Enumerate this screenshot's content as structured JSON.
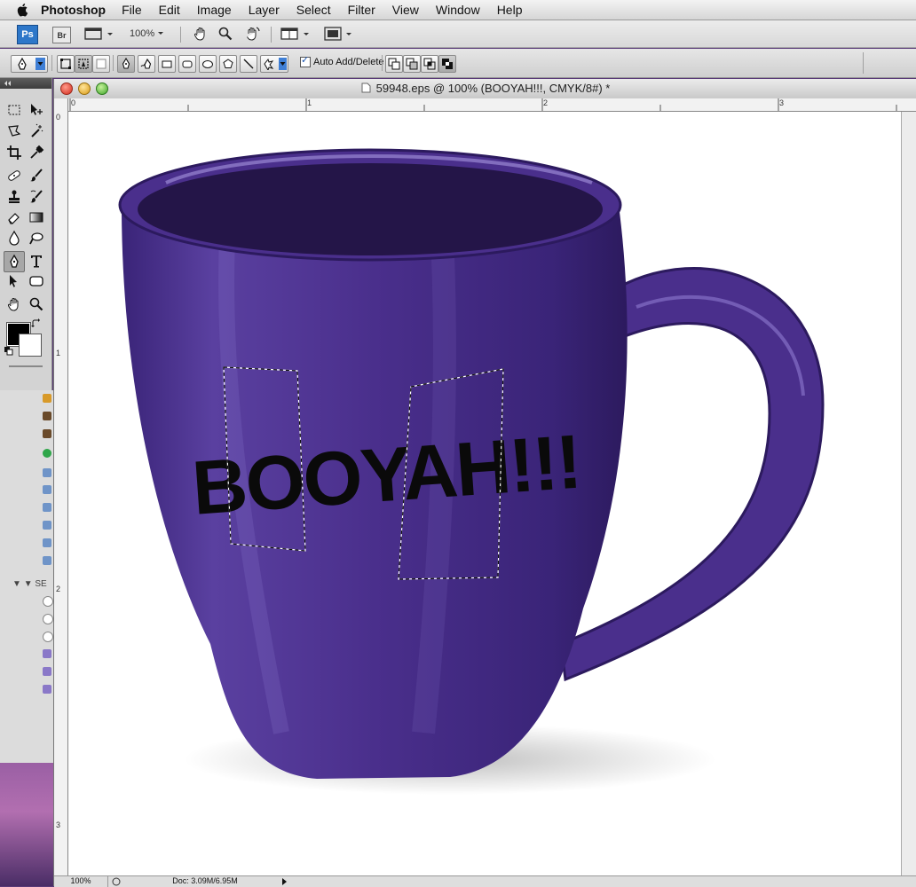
{
  "menubar": {
    "app_name": "Photoshop",
    "items": [
      "File",
      "Edit",
      "Image",
      "Layer",
      "Select",
      "Filter",
      "View",
      "Window",
      "Help"
    ]
  },
  "appbar": {
    "ps_logo": "Ps",
    "br_logo": "Br",
    "zoom_value": "100%"
  },
  "options": {
    "auto_add_label": "Auto Add/Delete",
    "auto_add_checked": true
  },
  "document": {
    "title": "59948.eps @ 100% (BOOYAH!!!, CMYK/8#) *",
    "text_layer": "BOOYAH!!!",
    "mug_color": "#4a2f8c"
  },
  "rulers": {
    "h_labels": [
      "0",
      "1",
      "2",
      "3"
    ],
    "v_labels": [
      "0",
      "1",
      "2",
      "3"
    ]
  },
  "side_panel": {
    "label": "SE"
  },
  "status": {
    "zoom": "100%",
    "doc_size": "Doc: 3.09M/6.95M"
  }
}
